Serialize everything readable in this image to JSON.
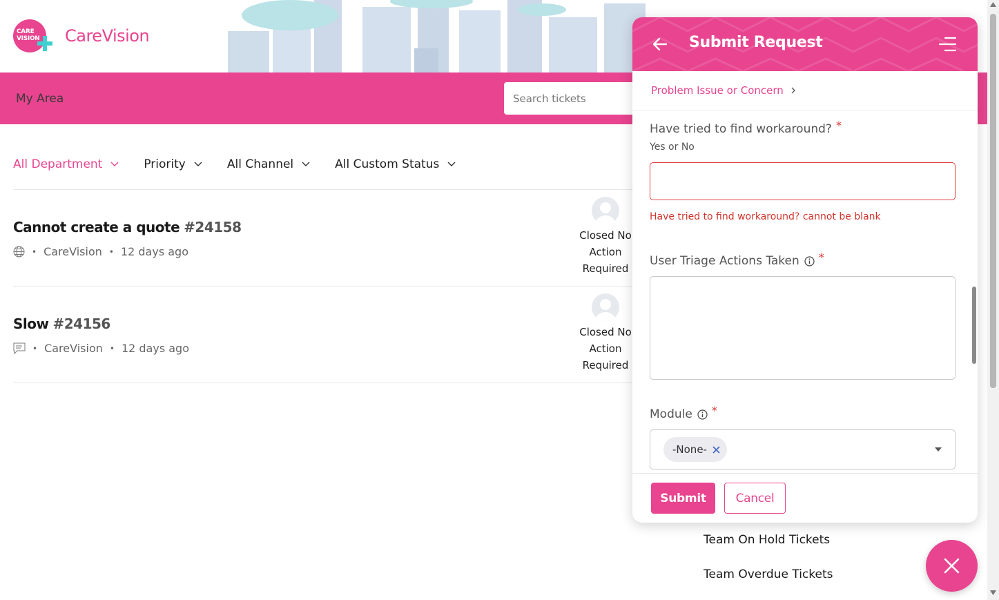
{
  "brand": {
    "logo_text_line1": "CARE",
    "logo_text_line2": "VISION",
    "name": "CareVision"
  },
  "nav": {
    "area_label": "My Area",
    "search_placeholder": "Search tickets"
  },
  "filters": [
    {
      "label": "All Department",
      "active": true
    },
    {
      "label": "Priority",
      "active": false
    },
    {
      "label": "All Channel",
      "active": false
    },
    {
      "label": "All Custom Status",
      "active": false
    }
  ],
  "tickets": [
    {
      "title": "Cannot create a quote",
      "number": "#24158",
      "channel_icon": "globe-icon",
      "org": "CareVision",
      "age": "12 days ago",
      "status": "Closed No Action Required"
    },
    {
      "title": "Slow",
      "number": "#24156",
      "channel_icon": "chat-icon",
      "org": "CareVision",
      "age": "12 days ago",
      "status": "Closed No Action Required"
    }
  ],
  "panel": {
    "title": "Submit Request",
    "breadcrumb": "Problem Issue or Concern",
    "fields": {
      "workaround": {
        "label": "Have tried to find workaround?",
        "required_mark": "*",
        "hint": "Yes or No",
        "value": "",
        "error": "Have tried to find workaround? cannot be blank"
      },
      "triage": {
        "label": "User Triage Actions Taken",
        "required_mark": "*",
        "value": ""
      },
      "module": {
        "label": "Module",
        "required_mark": "*",
        "selected": "-None-"
      }
    },
    "submit_label": "Submit",
    "cancel_label": "Cancel"
  },
  "team_links": [
    "Team On Hold Tickets",
    "Team Overdue Tickets"
  ],
  "colors": {
    "accent": "#e8448f",
    "error": "#d0342c"
  }
}
